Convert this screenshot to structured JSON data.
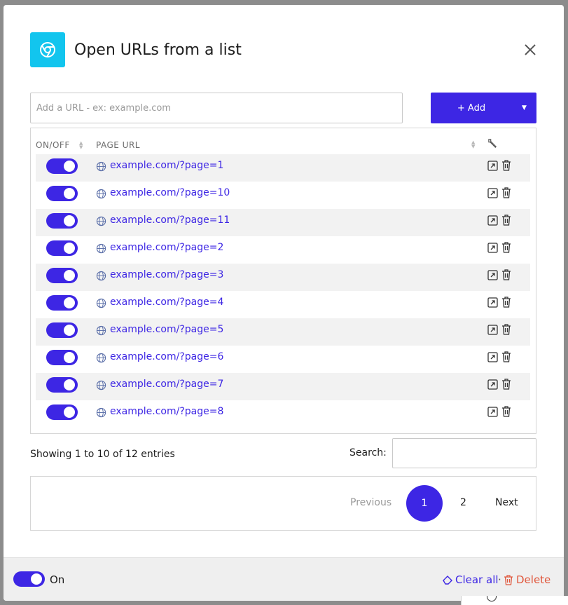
{
  "dialog": {
    "title": "Open URLs from a list",
    "app_icon": "chrome-icon",
    "close_icon": "close-icon"
  },
  "url_input": {
    "placeholder": "Add a URL - ex: example.com",
    "value": ""
  },
  "add_button": {
    "label": "+  Add",
    "dropdown_icon": "caret-down-icon"
  },
  "table": {
    "columns": [
      "ON/OFF",
      "PAGE URL"
    ],
    "actions_icon": "wrench-icon",
    "rows": [
      {
        "enabled": true,
        "url": "example.com/?page=1"
      },
      {
        "enabled": true,
        "url": "example.com/?page=10"
      },
      {
        "enabled": true,
        "url": "example.com/?page=11"
      },
      {
        "enabled": true,
        "url": "example.com/?page=2"
      },
      {
        "enabled": true,
        "url": "example.com/?page=3"
      },
      {
        "enabled": true,
        "url": "example.com/?page=4"
      },
      {
        "enabled": true,
        "url": "example.com/?page=5"
      },
      {
        "enabled": true,
        "url": "example.com/?page=6"
      },
      {
        "enabled": true,
        "url": "example.com/?page=7"
      },
      {
        "enabled": true,
        "url": "example.com/?page=8"
      }
    ]
  },
  "info": "Showing 1 to 10 of 12 entries",
  "search": {
    "label": "Search:",
    "value": ""
  },
  "pagination": {
    "previous": "Previous",
    "pages": [
      "1",
      "2"
    ],
    "current": "1",
    "next": "Next"
  },
  "footer": {
    "toggle_on": true,
    "toggle_label": "On",
    "clear_all": "Clear all",
    "separator": "·",
    "delete": "Delete"
  },
  "colors": {
    "accent": "#3d26e4",
    "app_icon_bg": "#12c5ee",
    "danger": "#e0573c",
    "row_stripe": "#f2f2f2"
  }
}
